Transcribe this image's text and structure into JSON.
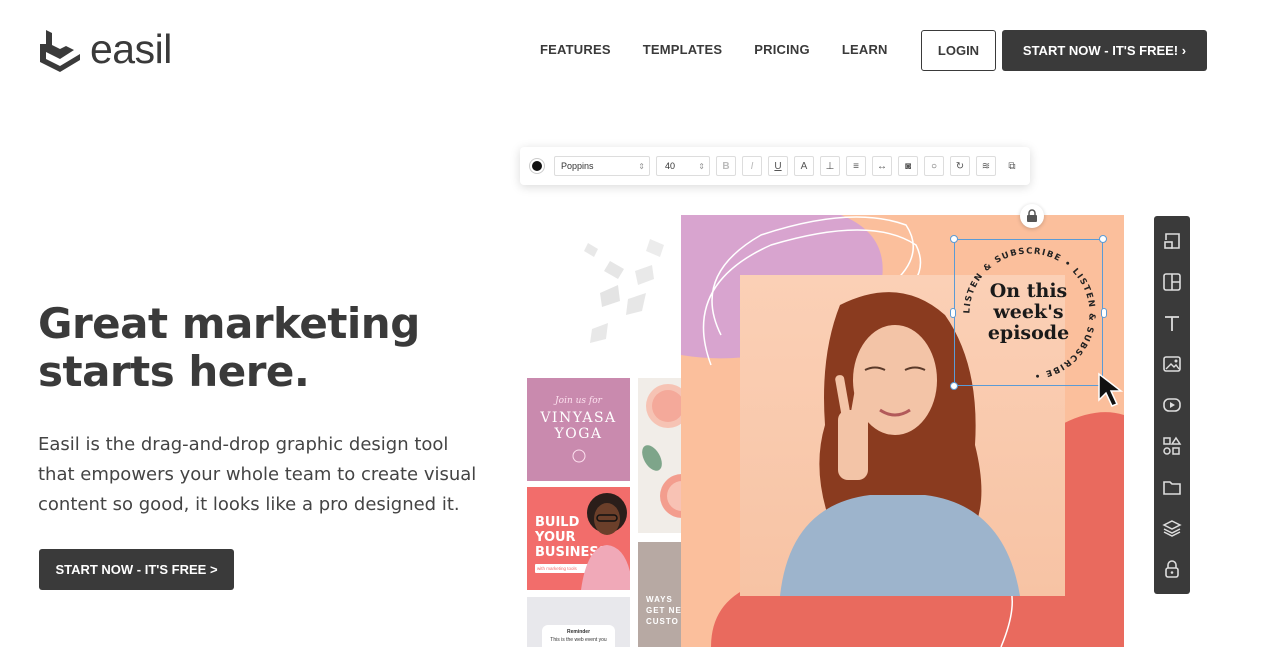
{
  "header": {
    "logo_text": "easil",
    "nav": [
      "FEATURES",
      "TEMPLATES",
      "PRICING",
      "LEARN"
    ],
    "login_label": "LOGIN",
    "start_label": "START NOW - IT'S FREE! ›"
  },
  "hero": {
    "title_line1": "Great marketing",
    "title_line2": "starts here.",
    "description": "Easil is the drag-and-drop graphic design tool that empowers your whole team to create visual content so good, it looks like a pro designed it.",
    "cta_label": "START NOW - IT'S FREE >"
  },
  "editor": {
    "font": "Poppins",
    "size": "40",
    "toolbar_tools": [
      "B",
      "I",
      "U",
      "A",
      "⊥",
      "≡",
      "↔",
      "◙",
      "○",
      "↻",
      "≋",
      "⧉"
    ],
    "selected_text_line1": "On this",
    "selected_text_line2": "week's",
    "selected_text_line3": "episode",
    "circular_text": "LISTEN & SUBSCRIBE • LISTEN & SUBSCRIBE • ",
    "sidebar_icons": [
      "resize-icon",
      "layout-icon",
      "text-icon",
      "image-icon",
      "video-icon",
      "shapes-icon",
      "folder-icon",
      "layers-icon",
      "lock-icon"
    ]
  },
  "templates": {
    "yoga_join": "Join us for",
    "yoga_line1": "VINYASA",
    "yoga_line2": "YOGA",
    "build_line1": "BUILD",
    "build_line2": "YOUR",
    "build_line3": "BUSINESS",
    "build_sub": "with marketing tools",
    "reminder_title": "Reminder",
    "reminder_body": "This is the web event you",
    "ways_line1": "WAYS",
    "ways_line2": "GET NE",
    "ways_line3": "CUSTO"
  },
  "colors": {
    "dark": "#3a3a3a",
    "canvas_peach": "#fbbf9c",
    "canvas_coral": "#e96a5e",
    "canvas_pink": "#d8a4cf",
    "selection_blue": "#5b9bd5"
  }
}
